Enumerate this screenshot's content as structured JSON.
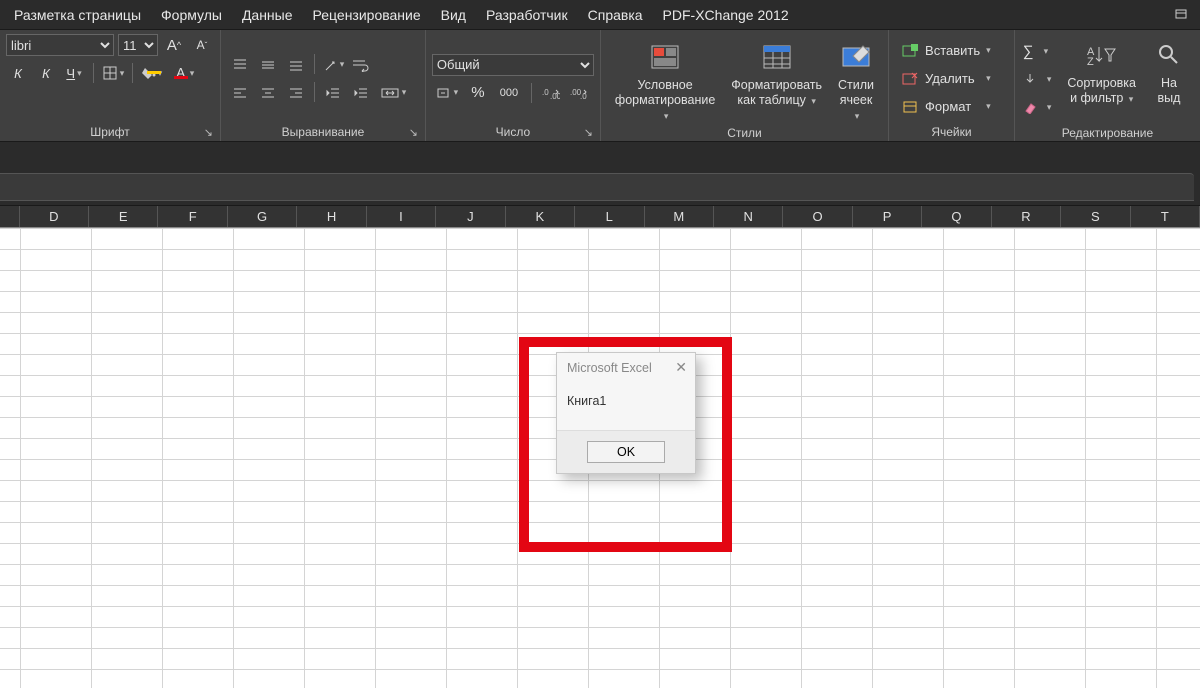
{
  "menubar": {
    "items": [
      "Разметка страницы",
      "Формулы",
      "Данные",
      "Рецензирование",
      "Вид",
      "Разработчик",
      "Справка",
      "PDF-XChange 2012"
    ]
  },
  "font": {
    "name": "libri",
    "size": "11",
    "bold_hint": "К",
    "italic_hint": "К",
    "underline_hint": "Ч",
    "group_label": "Шрифт"
  },
  "alignment": {
    "group_label": "Выравнивание"
  },
  "number": {
    "format": "Общий",
    "thousands_hint": "000",
    "group_label": "Число"
  },
  "styles": {
    "conditional": {
      "line1": "Условное",
      "line2": "форматирование"
    },
    "format_table": {
      "line1": "Форматировать",
      "line2": "как таблицу"
    },
    "cell_styles": {
      "line1": "Стили",
      "line2": "ячеек"
    },
    "group_label": "Стили"
  },
  "cells": {
    "insert": "Вставить",
    "delete": "Удалить",
    "format": "Формат",
    "group_label": "Ячейки"
  },
  "editing": {
    "sort": {
      "line1": "Сортировка",
      "line2": "и фильтр"
    },
    "find": {
      "line1": "На",
      "line2": "выд"
    },
    "group_label": "Редактирование"
  },
  "columns": [
    "D",
    "E",
    "F",
    "G",
    "H",
    "I",
    "J",
    "K",
    "L",
    "M",
    "N",
    "O",
    "P",
    "Q",
    "R",
    "S",
    "T"
  ],
  "dialog": {
    "title": "Microsoft Excel",
    "message": "Книга1",
    "ok": "OK"
  }
}
